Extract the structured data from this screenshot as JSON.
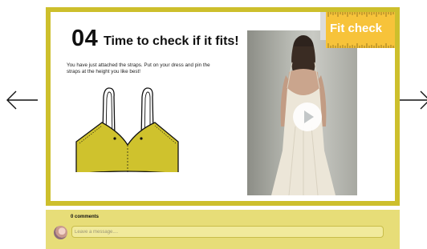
{
  "navigation": {
    "prev_icon": "arrow-left-icon",
    "next_icon": "arrow-right-icon"
  },
  "slide": {
    "step_number": "04",
    "title": "Time to check if it fits!",
    "description": "You have just attached the straps. Put on your dress and pin the straps at the height you like best!",
    "badge": "Fit check",
    "play_icon": "play-icon",
    "illustration_icon": "dress-bodice-icon"
  },
  "comments": {
    "count_label": "0 comments",
    "input_placeholder": "Leave a message....",
    "avatar_icon": "avatar"
  },
  "colors": {
    "frame": "#cdbf2c",
    "garment": "#cfc22d",
    "comments_bg": "#e7dd78",
    "badge_bg": "#f7c33a"
  }
}
